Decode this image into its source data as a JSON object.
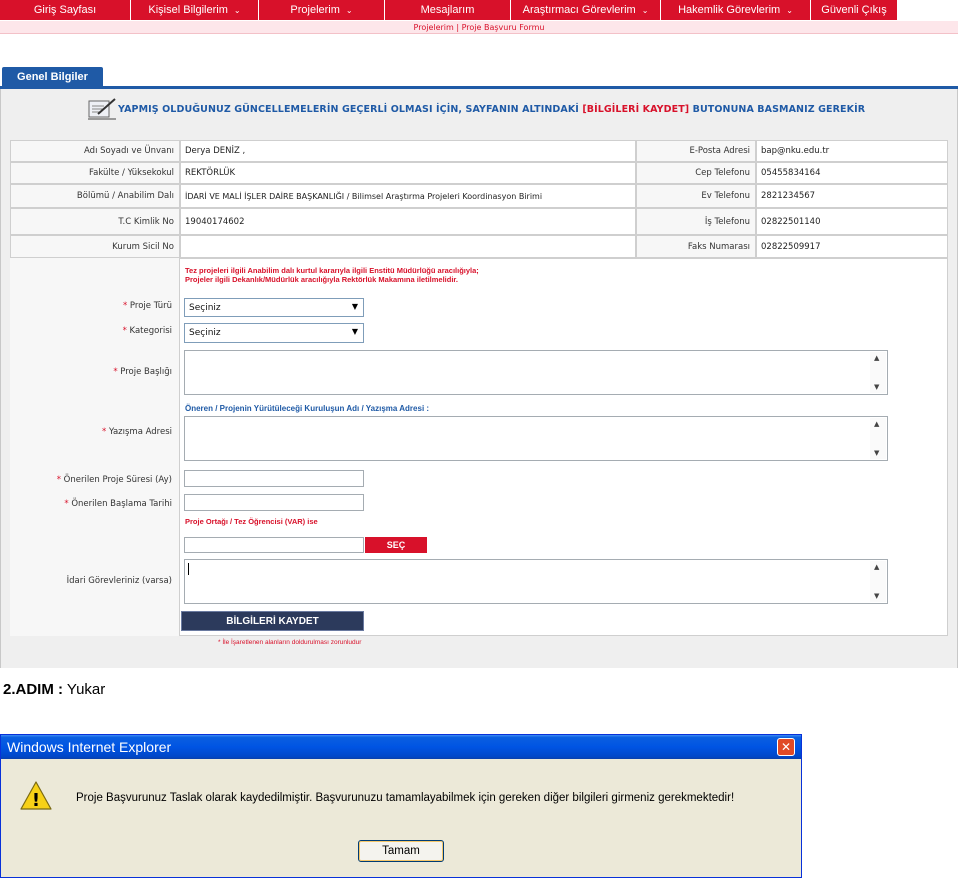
{
  "nav": {
    "tabs": [
      {
        "label": "Giriş Sayfası",
        "chevron": false
      },
      {
        "label": "Kişisel Bilgilerim",
        "chevron": true
      },
      {
        "label": "Projelerim",
        "chevron": true
      },
      {
        "label": "Mesajlarım",
        "chevron": false
      },
      {
        "label": "Araştırmacı Görevlerim",
        "chevron": true
      },
      {
        "label": "Hakemlik Görevlerim",
        "chevron": true
      },
      {
        "label": "Güvenli Çıkış",
        "chevron": false
      }
    ],
    "breadcrumb": "Projelerim | Proje Başvuru Formu"
  },
  "tab_label": "Genel Bilgiler",
  "notice": {
    "text_before": "YAPMIŞ OLDUĞUNUZ GÜNCELLEMELERİN GEÇERLİ OLMASI İÇİN, SAYFANIN ALTINDAKİ ",
    "highlight": "[BİLGİLERİ KAYDET]",
    "text_after": " BUTONUNA BASMANIZ GEREKİR"
  },
  "info_rows": [
    {
      "label": "Adı Soyadı ve Ünvanı",
      "value": "Derya DENİZ ,",
      "label2": "E-Posta Adresi",
      "value2": "bap@nku.edu.tr"
    },
    {
      "label": "Fakülte / Yüksekokul",
      "value": "REKTÖRLÜK",
      "label2": "Cep Telefonu",
      "value2": "05455834164"
    },
    {
      "label": "Bölümü / Anabilim Dalı",
      "value": "İDARİ VE MALİ İŞLER DAİRE BAŞKANLIĞI / Bilimsel Araştırma Projeleri Koordinasyon Birimi",
      "label2": "Ev Telefonu",
      "value2": "2821234567"
    },
    {
      "label": "T.C Kimlik No",
      "value": "19040174602",
      "label2": "İş Telefonu",
      "value2": "02822501140"
    },
    {
      "label": "Kurum Sicil No",
      "value": "",
      "label2": "Faks Numarası",
      "value2": "02822509917"
    }
  ],
  "form": {
    "info_line1": "Tez projeleri ilgili Anabilim dalı kurtul kararıyla ilgili Enstitü Müdürlüğü aracılığıyla;",
    "info_line2": "Projeler ilgili Dekanlık/Müdürlük aracılığıyla Rektörlük Makamına iletilmelidir.",
    "proje_turu_label": "Proje Türü",
    "proje_turu_value": "Seçiniz",
    "kategori_label": "Kategorisi",
    "kategori_value": "Seçiniz",
    "proje_basligi_label": "Proje Başlığı",
    "yazisma_info": "Öneren / Projenin Yürütüleceği Kuruluşun Adı / Yazışma Adresi :",
    "yazisma_label": "Yazışma Adresi",
    "sure_label": "Önerilen Proje Süresi (Ay)",
    "baslama_label": "Önerilen Başlama Tarihi",
    "ortak_info": "Proje Ortağı / Tez Öğrencisi (VAR) ise",
    "sec_button": "SEÇ",
    "idari_label": "İdari Görevleriniz (varsa)",
    "save_button": "BİLGİLERİ KAYDET",
    "required_note": "* İle İşaretlenen alanların doldurulması zorunludur",
    "required_mark": "*"
  },
  "step": {
    "bold": "2.ADIM :",
    "text": " Yukar"
  },
  "dialog": {
    "title": "Windows Internet Explorer",
    "message": "Proje Başvurunuz Taslak olarak kaydedilmiştir. Başvurunuzu tamamlayabilmek için gereken diğer bilgileri girmeniz gerekmektedir!",
    "ok_button": "Tamam",
    "close_glyph": "✕",
    "warning_glyph": "!"
  }
}
